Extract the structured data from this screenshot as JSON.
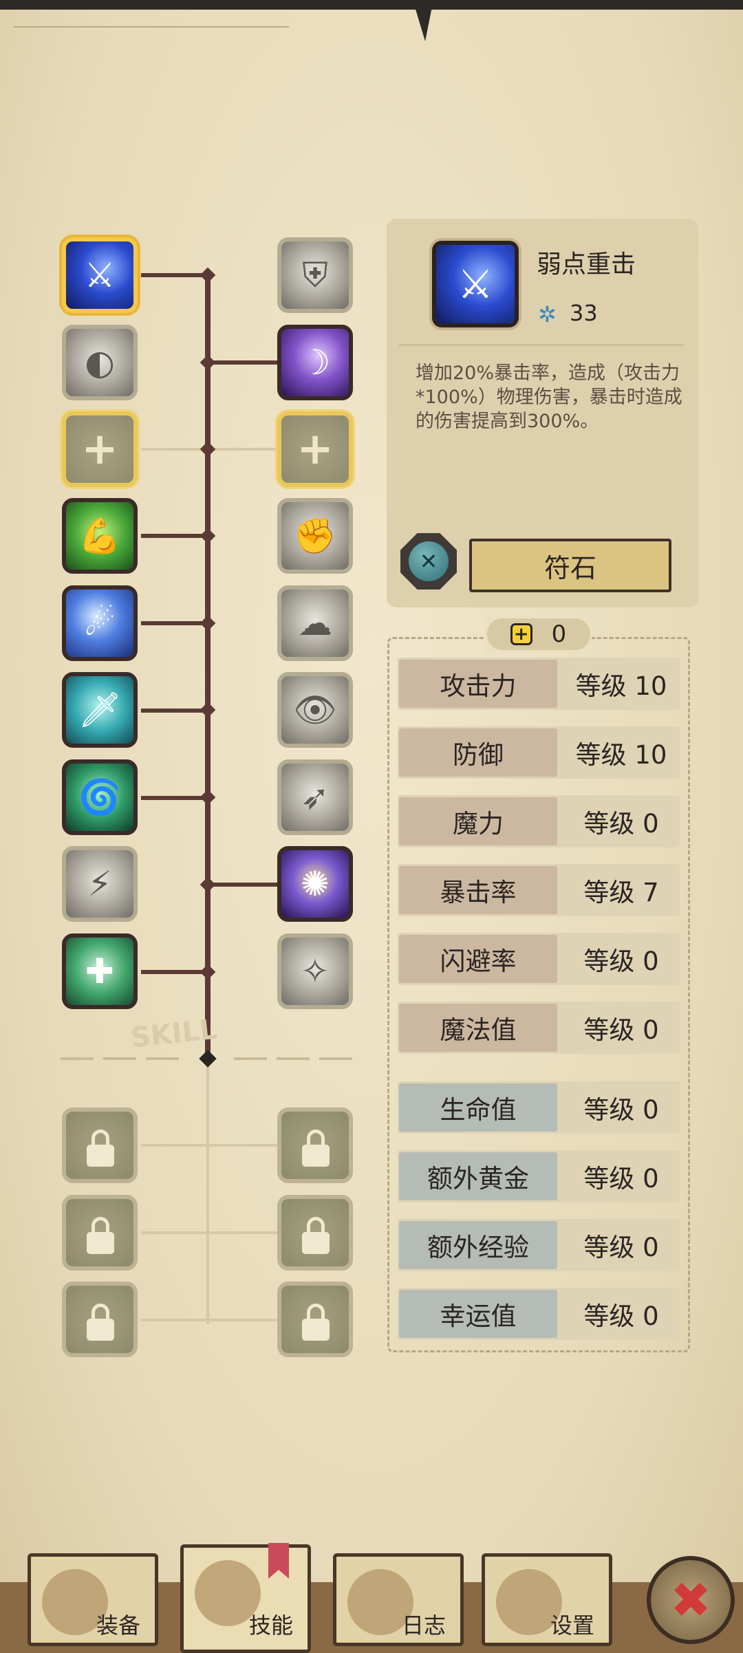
{
  "detail": {
    "name": "弱点重击",
    "cost": "33",
    "description": "增加20%暴击率，造成（攻击力*100%）物理伤害，暴击时造成的伤害提高到300%。",
    "rune_button": "符石",
    "rune_gem_symbol": "✕"
  },
  "tree": {
    "watermark": "SKILL"
  },
  "points": {
    "icon": "plus-icon",
    "value": "0"
  },
  "stats": [
    {
      "label": "攻击力",
      "level": "等级 10"
    },
    {
      "label": "防御",
      "level": "等级 10"
    },
    {
      "label": "魔力",
      "level": "等级 0"
    },
    {
      "label": "暴击率",
      "level": "等级 7"
    },
    {
      "label": "闪避率",
      "level": "等级 0"
    },
    {
      "label": "魔法值",
      "level": "等级 0"
    },
    {
      "label": "生命值",
      "level": "等级 0"
    },
    {
      "label": "额外黄金",
      "level": "等级 0"
    },
    {
      "label": "额外经验",
      "level": "等级 0"
    },
    {
      "label": "幸运值",
      "level": "等级 0"
    }
  ],
  "tabs": [
    {
      "label": "装备"
    },
    {
      "label": "技能"
    },
    {
      "label": "日志"
    },
    {
      "label": "设置"
    }
  ],
  "close": {
    "symbol": "✖"
  },
  "colors": {
    "background": "#ebe0c2",
    "branch": "#5b3a35",
    "selected_border": "#f4c94a",
    "close_x": "#d23a3a"
  }
}
